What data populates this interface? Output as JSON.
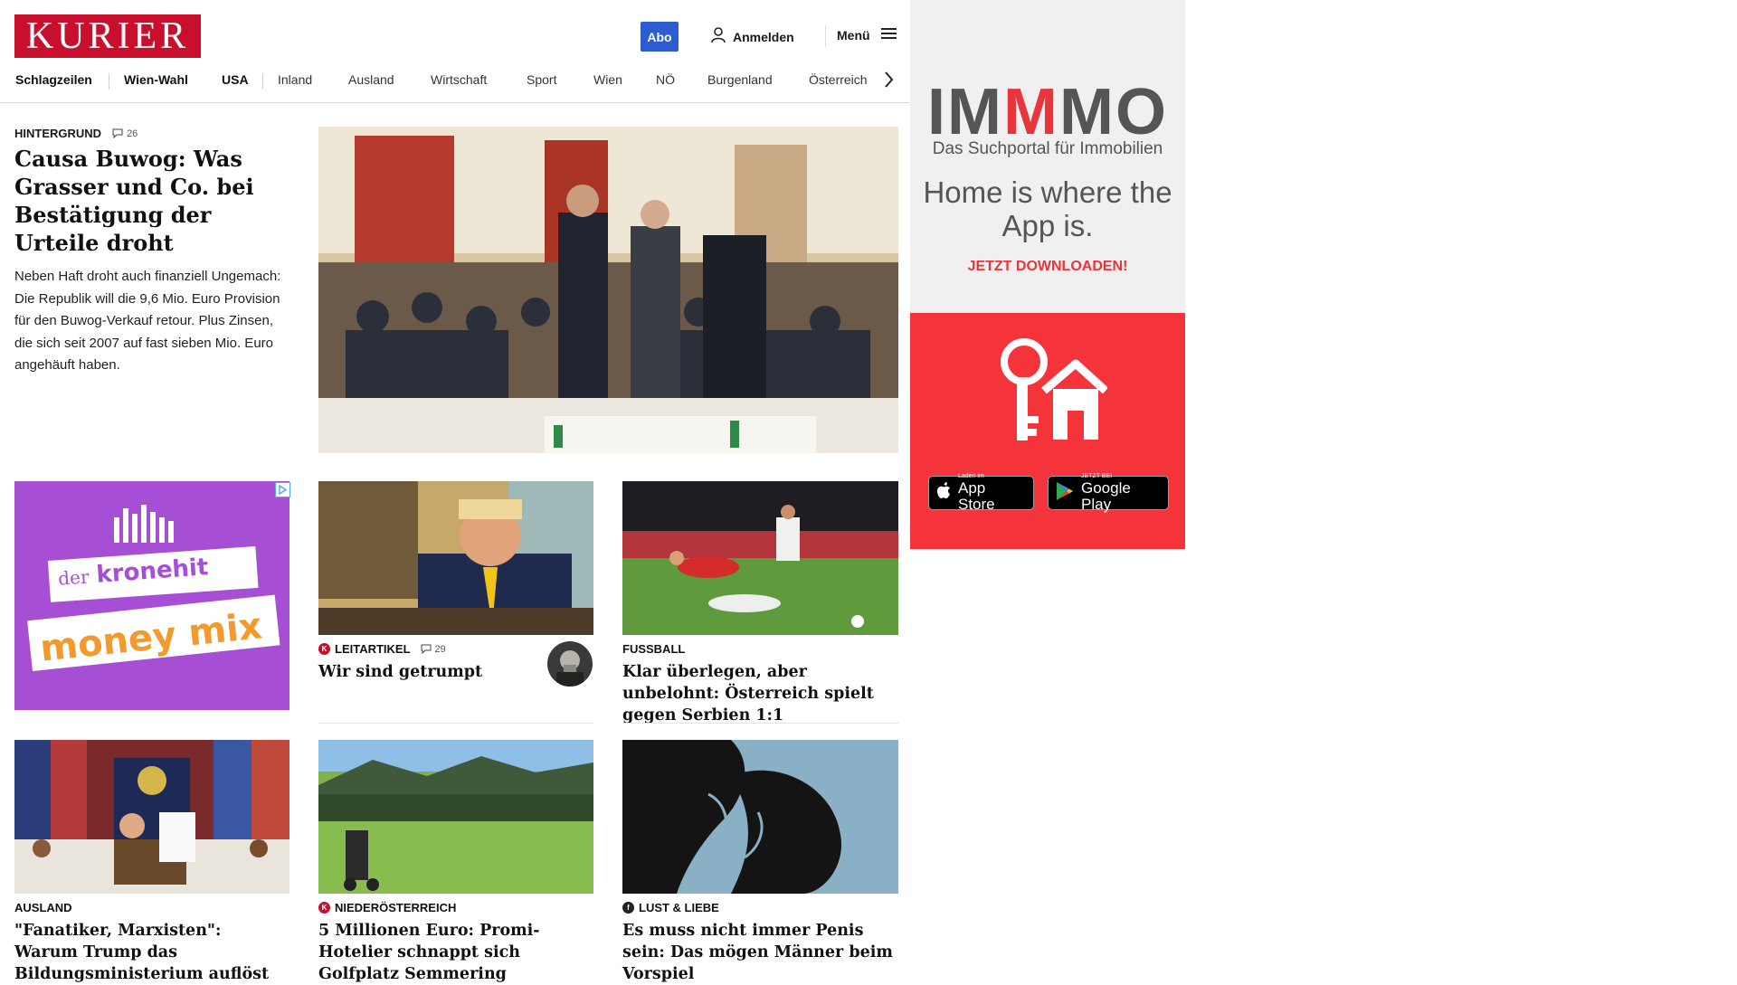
{
  "header": {
    "logo": "KURIER",
    "abo": "Abo",
    "login": "Anmelden",
    "menu": "Menü"
  },
  "nav": {
    "items": [
      "Schlagzeilen",
      "Wien-Wahl",
      "USA",
      "Inland",
      "Ausland",
      "Wirtschaft",
      "Sport",
      "Wien",
      "NÖ",
      "Burgenland",
      "Österreich"
    ]
  },
  "lead": {
    "kicker": "HINTERGRUND",
    "comments": "26",
    "title": "Causa Buwog: Was Grasser und Co. bei Bestätigung der Urteile droht",
    "teaser": "Neben Haft droht auch finanziell Ungemach: Die Republik will die 9,6 Mio. Euro Provision für den Buwog-Verkauf retour. Plus Zinsen, die sich seit 2007 auf fast sieben Mio. Euro angehäuft haben."
  },
  "promo": {
    "line1": "der",
    "line2": "kronehit",
    "line3": "money mix"
  },
  "cards": [
    {
      "kicker": "LEITARTIKEL",
      "badge": "K",
      "comments": "29",
      "title": "Wir sind getrumpt"
    },
    {
      "kicker": "FUSSBALL",
      "title": "Klar überlegen, aber unbelohnt: Österreich spielt gegen Serbien 1:1"
    },
    {
      "kicker": "AUSLAND",
      "title": "\"Fanatiker, Marxisten\": Warum Trump das Bildungsministerium auflöst"
    },
    {
      "kicker": "NIEDERÖSTERREICH",
      "badge": "K",
      "title": "5 Millionen Euro: Promi-Hotelier schnappt sich Golfplatz Semmering"
    },
    {
      "kicker": "LUST & LIEBE",
      "badge": "f",
      "title": "Es muss nicht immer Penis sein: Das mögen Männer beim Vorspiel"
    }
  ],
  "ad": {
    "brand": "IMMMO",
    "subtitle": "Das Suchportal für Immobilien",
    "headline": "Home is where the App is.",
    "cta": "JETZT DOWNLOADEN!",
    "appstore_small": "Laden im",
    "appstore_big": "App Store",
    "play_small": "JETZT BEI",
    "play_big": "Google Play"
  },
  "colors": {
    "brand": "#c8102e",
    "abo": "#2d5bd0",
    "ad_red": "#f4343a",
    "promo_purple": "#a64fd4"
  }
}
